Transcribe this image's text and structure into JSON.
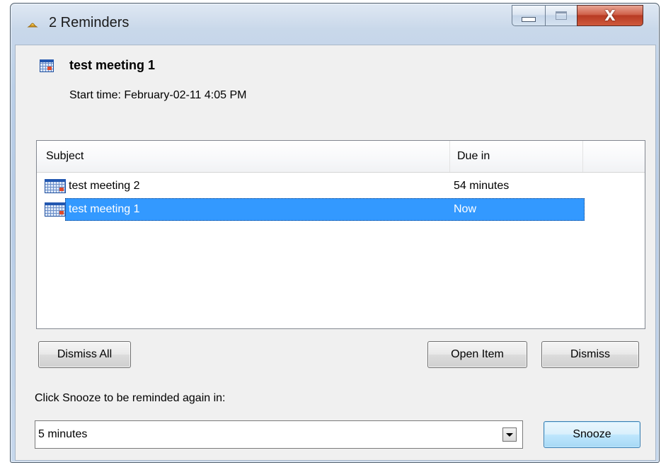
{
  "window": {
    "title": "2 Reminders",
    "controls": {
      "minimize": "minimize",
      "maximize": "maximize",
      "close": "X"
    }
  },
  "header": {
    "subject": "test meeting 1",
    "start_time": "Start time: February-02-11 4:05 PM"
  },
  "list": {
    "columns": [
      "Subject",
      "Due in"
    ],
    "rows": [
      {
        "subject": "test meeting 2",
        "due": "54 minutes",
        "selected": false,
        "icon": "calendar-icon"
      },
      {
        "subject": "test meeting 1",
        "due": "Now",
        "selected": true,
        "icon": "calendar-icon"
      }
    ]
  },
  "buttons": {
    "dismiss_all": "Dismiss All",
    "open_item": "Open Item",
    "dismiss": "Dismiss",
    "snooze": "Snooze"
  },
  "snooze": {
    "label": "Click Snooze to be reminded again in:",
    "selected": "5 minutes"
  },
  "colors": {
    "selection": "#3399ff",
    "close_button": "#c8472d",
    "title_gradient": "#bcd0e8"
  }
}
